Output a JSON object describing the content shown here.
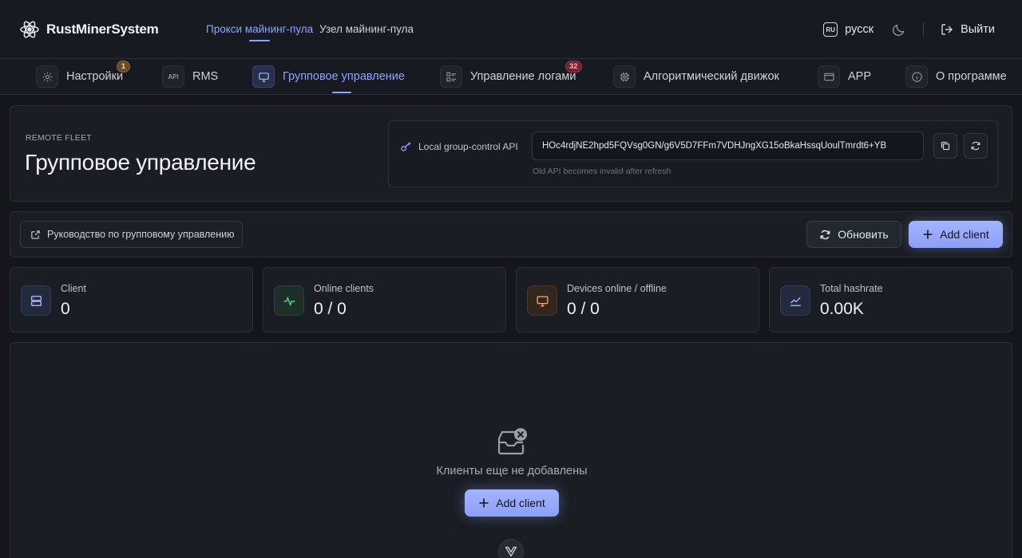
{
  "brand": {
    "name": "RustMinerSystem"
  },
  "topnav": [
    {
      "label": "Прокси майнинг-пула",
      "active": true
    },
    {
      "label": "Узел майнинг-пула",
      "active": false
    }
  ],
  "header": {
    "lang_badge": "RU",
    "lang_label": "русск",
    "logout_label": "Выйти"
  },
  "tabs": [
    {
      "label": "Настройки",
      "icon": "gear-icon",
      "badge": "1"
    },
    {
      "label": "RMS",
      "icon": "api-icon",
      "icon_text": "API"
    },
    {
      "label": "Групповое управление",
      "icon": "monitor-icon",
      "active": true
    },
    {
      "label": "Управление логами",
      "icon": "list-icon",
      "badge": "32"
    },
    {
      "label": "Алгоритмический движок",
      "icon": "chip-icon"
    },
    {
      "label": "APP",
      "icon": "window-icon"
    },
    {
      "label": "О программе",
      "icon": "info-icon"
    }
  ],
  "hero": {
    "eyebrow": "REMOTE FLEET",
    "title": "Групповое управление",
    "api_label": "Local group-control API",
    "api_value": "HOc4rdjNE2hpd5FQVsg0GN/g6V5D7FFm7VDHJngXG15oBkaHssqUoulTmrdt6+YB",
    "api_hint": "Old API becomes invalid after refresh"
  },
  "actions": {
    "guide_label": "Руководство по групповому управлению",
    "refresh_label": "Обновить",
    "add_label": "Add client"
  },
  "stats": [
    {
      "label": "Client",
      "value": "0",
      "icon": "server-icon"
    },
    {
      "label": "Online clients",
      "value": "0 / 0",
      "icon": "activity-icon"
    },
    {
      "label": "Devices online / offline",
      "value": "0 / 0",
      "icon": "monitor-icon"
    },
    {
      "label": "Total hashrate",
      "value": "0.00K",
      "icon": "chart-icon"
    }
  ],
  "empty": {
    "text": "Клиенты еще не добавлены",
    "add_label": "Add client"
  },
  "colors": {
    "accent": "#8fa4ff",
    "background": "#14161b",
    "card": "#1a1d23",
    "green": "#4fd08a",
    "orange": "#f0a060"
  }
}
